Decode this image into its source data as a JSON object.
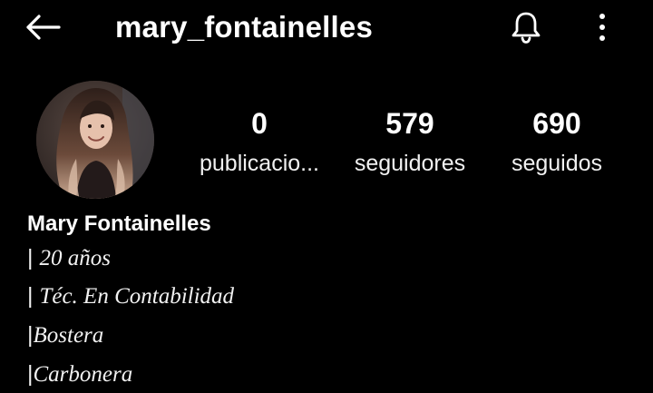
{
  "header": {
    "username": "mary_fontainelles",
    "back_icon": "arrow-left-icon",
    "notifications_icon": "bell-icon",
    "menu_icon": "more-vertical-icon"
  },
  "profile": {
    "full_name": "Mary Fontainelles",
    "stats": [
      {
        "value": "0",
        "label": "publicacio..."
      },
      {
        "value": "579",
        "label": "seguidores"
      },
      {
        "value": "690",
        "label": "seguidos"
      }
    ],
    "bio": [
      {
        "bar": "| ",
        "text": "20 años"
      },
      {
        "bar": "| ",
        "text": "Téc. En Contabilidad"
      },
      {
        "bar": "|",
        "text": "Bostera"
      },
      {
        "bar": "|",
        "text": "Carbonera"
      }
    ]
  },
  "colors": {
    "background": "#000000",
    "text": "#ffffff",
    "secondary_text": "#f1f1f1"
  }
}
